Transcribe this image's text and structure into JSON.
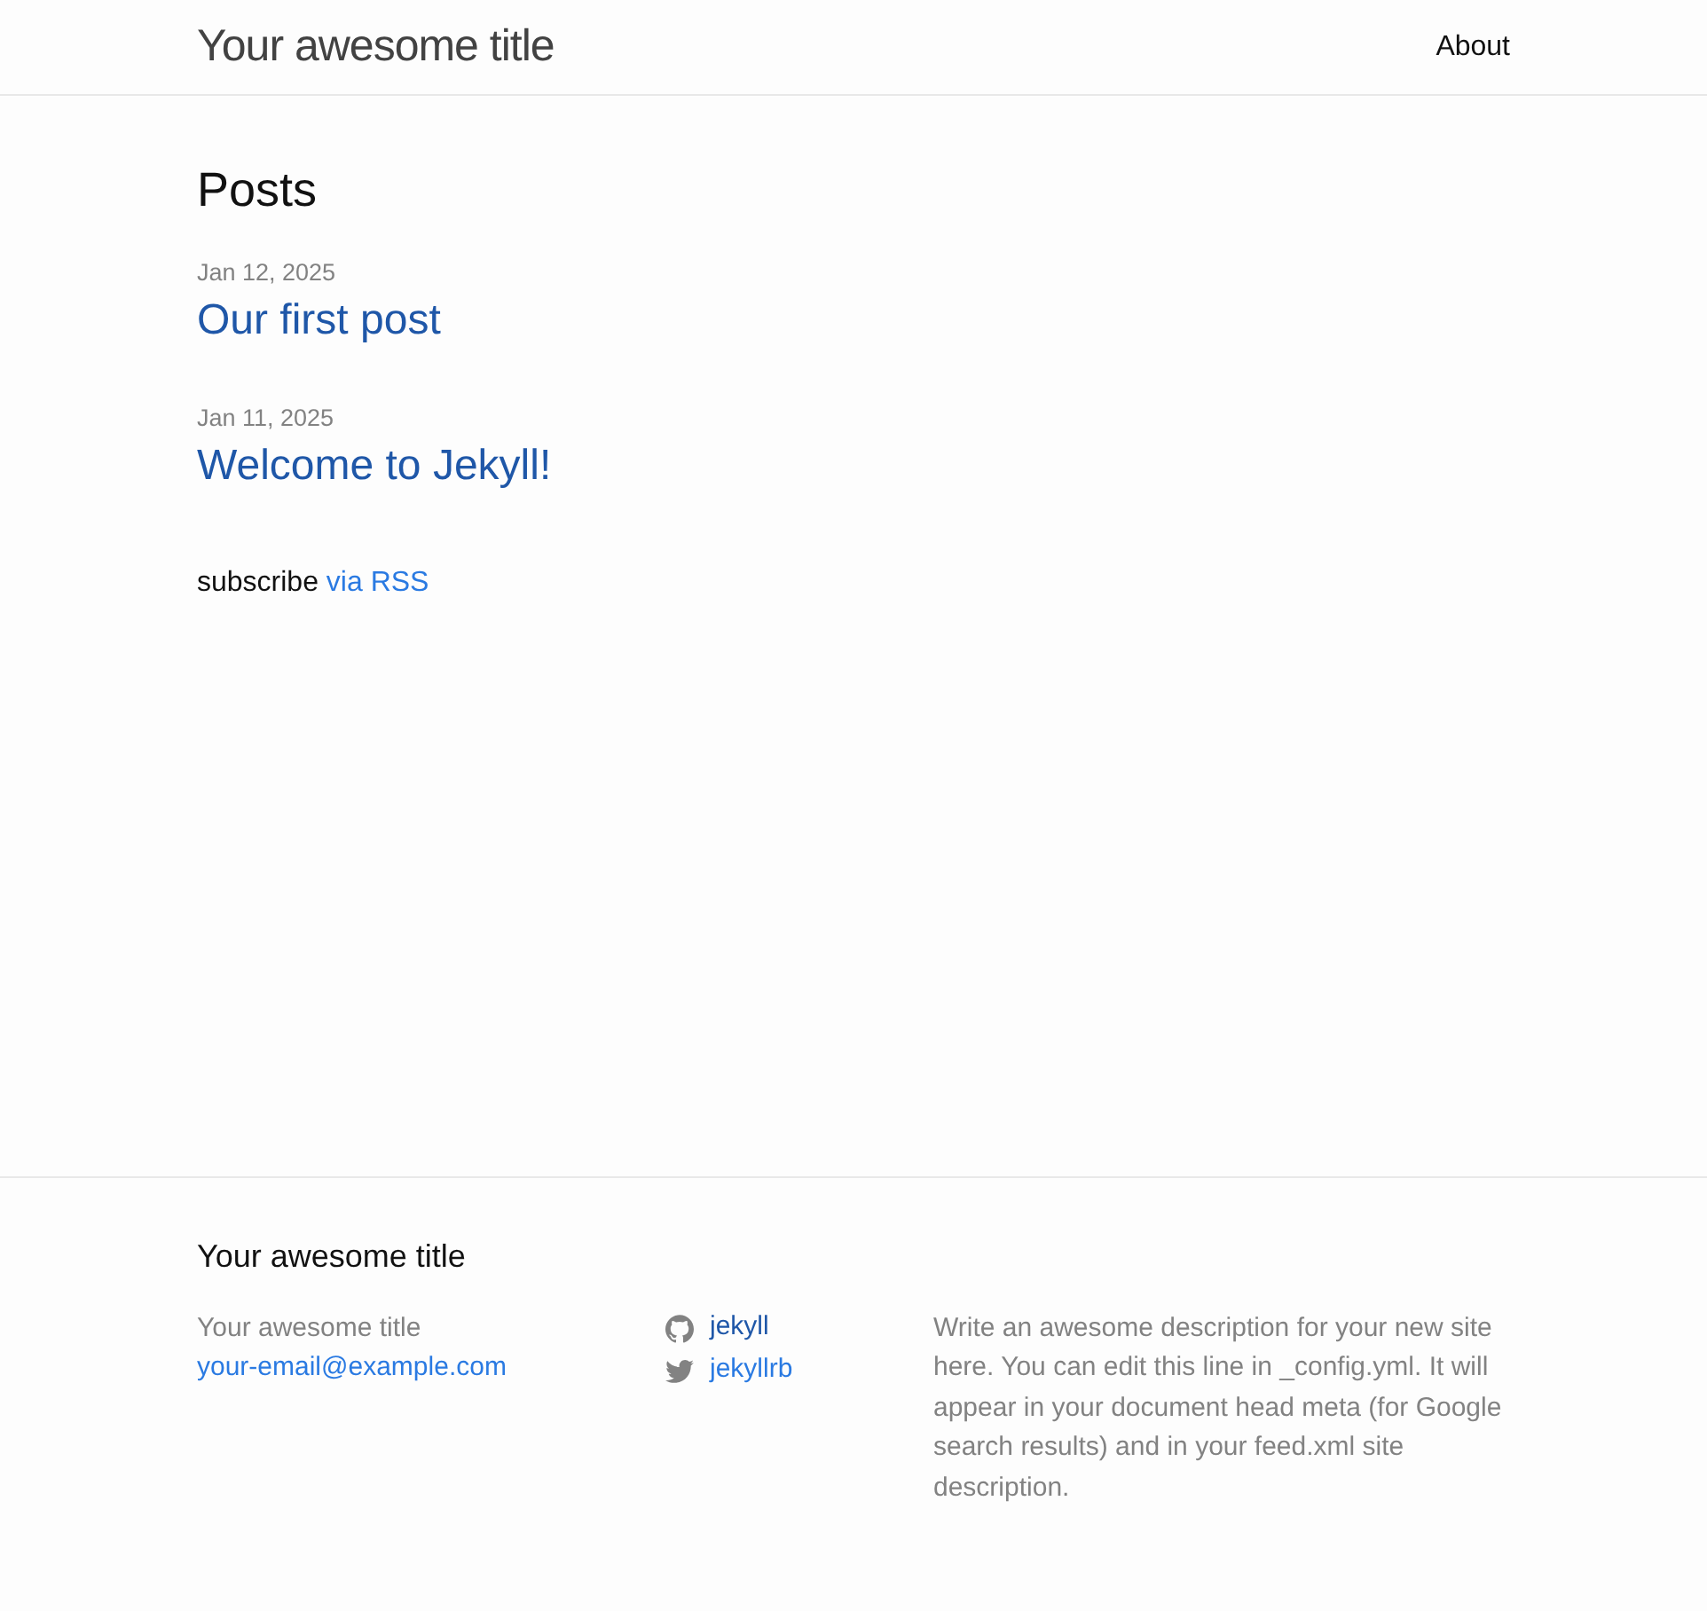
{
  "header": {
    "site_title": "Your awesome title",
    "nav": [
      {
        "label": "About"
      }
    ]
  },
  "main": {
    "heading": "Posts",
    "posts": [
      {
        "date": "Jan 12, 2025",
        "title": "Our first post",
        "visited": true
      },
      {
        "date": "Jan 11, 2025",
        "title": "Welcome to Jekyll!",
        "visited": true
      }
    ],
    "subscribe": {
      "text": "subscribe",
      "link": "via RSS",
      "visited": false
    }
  },
  "footer": {
    "heading": "Your awesome title",
    "contact": {
      "name": "Your awesome title",
      "email": "your-email@example.com",
      "visited": false
    },
    "social": [
      {
        "kind": "github",
        "label": "jekyll",
        "visited": true
      },
      {
        "kind": "twitter",
        "label": "jekyllrb",
        "visited": false
      }
    ],
    "description": "Write an awesome description for your new site here. You can edit this line in _config.yml. It will appear in your document head meta (for Google search results) and in your feed.xml site description."
  }
}
